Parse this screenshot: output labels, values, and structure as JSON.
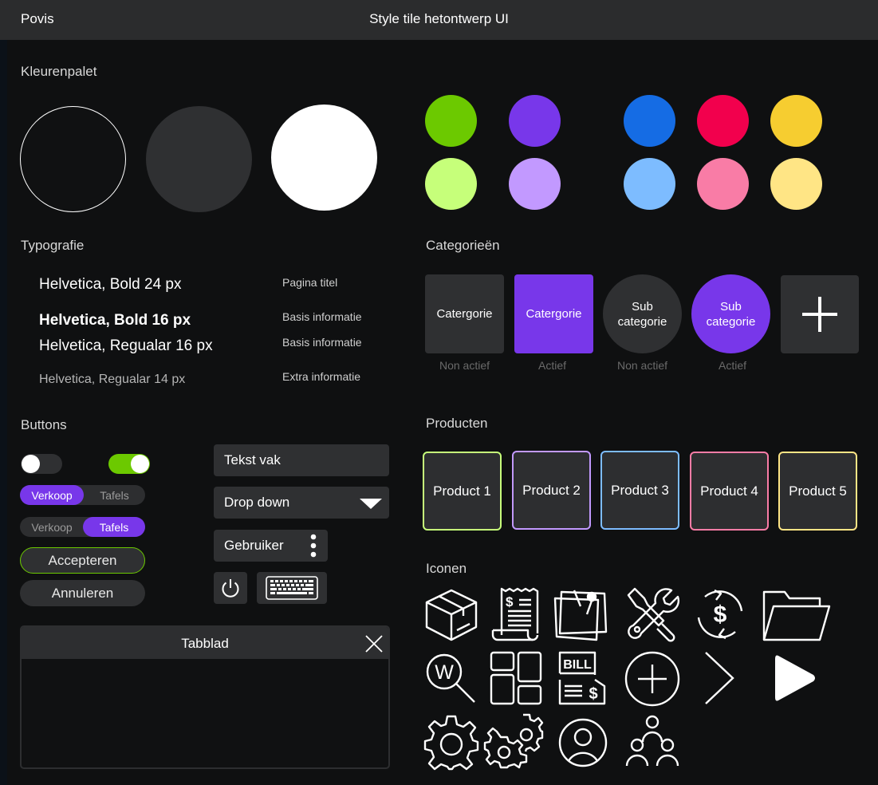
{
  "app": {
    "name": "Povis",
    "title": "Style tile hetontwerp UI"
  },
  "sections": {
    "colors": "Kleurenpalet",
    "typography": "Typografie",
    "categories": "Categorieën",
    "buttons": "Buttons",
    "products": "Producten",
    "icons": "Iconen"
  },
  "palette": {
    "large": [
      "#101112",
      "#2f3032",
      "#ffffff"
    ],
    "large_outline": "#ffffff",
    "swatches": [
      {
        "dark": "#6cc900",
        "light": "#c6ff7a"
      },
      {
        "dark": "#7837ea",
        "light": "#c299ff"
      },
      {
        "dark": "#156ce4",
        "light": "#7dbcff"
      },
      {
        "dark": "#f2004d",
        "light": "#f97ca6"
      },
      {
        "dark": "#f6cd30",
        "light": "#ffe585"
      }
    ]
  },
  "typography": [
    {
      "sample": "Helvetica, Bold 24 px",
      "usage": "Pagina titel"
    },
    {
      "sample": "Helvetica, Bold 16 px",
      "usage": "Basis informatie"
    },
    {
      "sample": "Helvetica, Regualar 16 px",
      "usage": "Basis informatie"
    },
    {
      "sample": "Helvetica, Regualar 14 px",
      "usage": "Extra informatie"
    }
  ],
  "categories": [
    {
      "label": "Catergorie",
      "state": "Non actief"
    },
    {
      "label": "Catergorie",
      "state": "Actief"
    },
    {
      "label": "Sub categorie",
      "state": "Non actief"
    },
    {
      "label": "Sub categorie",
      "state": "Actief"
    }
  ],
  "accent": "#7837ea",
  "buttons": {
    "toggle_off_color": "#2f3032",
    "toggle_on_color": "#6cc900",
    "seg1": {
      "left": "Verkoop",
      "right": "Tafels",
      "active": "left"
    },
    "seg2": {
      "left": "Verkoop",
      "right": "Tafels",
      "active": "right"
    },
    "accept": "Accepteren",
    "cancel": "Annuleren",
    "text_field": "Tekst vak",
    "dropdown": "Drop down",
    "user": "Gebruiker",
    "power_icon": "power-icon",
    "keyboard_icon": "keyboard-icon"
  },
  "tab": {
    "title": "Tabblad",
    "close_icon": "close-icon"
  },
  "products": [
    {
      "label": "Product 1",
      "color": "#c6ff7a"
    },
    {
      "label": "Product 2",
      "color": "#c299ff"
    },
    {
      "label": "Product 3",
      "color": "#7dbcff"
    },
    {
      "label": "Product 4",
      "color": "#f97ca6"
    },
    {
      "label": "Product 5",
      "color": "#ffe585"
    }
  ],
  "icons": [
    "box-icon",
    "receipt-icon",
    "notes-icon",
    "tools-icon",
    "dollar-refresh-icon",
    "folder-icon",
    "search-w-icon",
    "grid-layout-icon",
    "bill-icon",
    "add-circle-icon",
    "chevron-right-icon",
    "play-icon",
    "gear-icon",
    "gears-icon",
    "user-circle-icon",
    "users-group-icon"
  ],
  "icon_texts": {
    "bill": "BILL",
    "dollar": "$",
    "w": "W"
  }
}
